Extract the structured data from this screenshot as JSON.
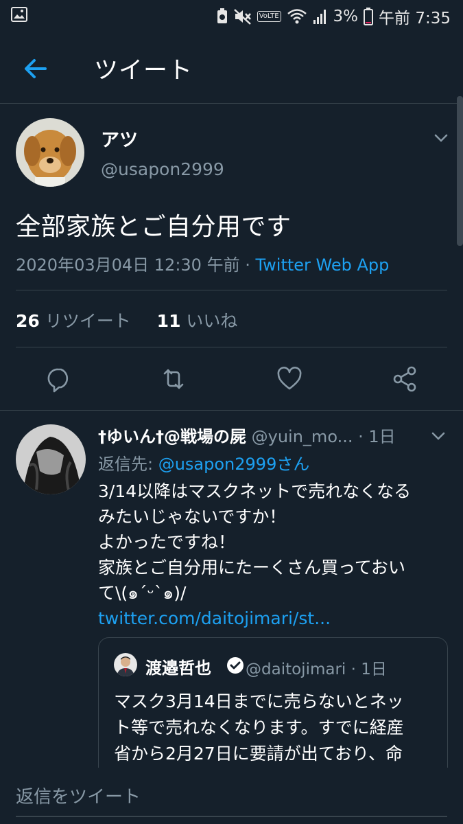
{
  "status_bar": {
    "battery": "3%",
    "time": "午前 7:35",
    "volte": "VoLTE"
  },
  "header": {
    "title": "ツイート"
  },
  "tweet": {
    "display_name": "アツ",
    "handle": "@usapon2999",
    "text": "全部家族とご自分用です",
    "timestamp": "2020年03月04日 12:30 午前",
    "separator": " · ",
    "source": "Twitter Web App",
    "retweet_count": "26",
    "retweet_label": "リツイート",
    "like_count": "11",
    "like_label": "いいね"
  },
  "reply": {
    "display_name": "†ゆいん†@戦場の屍",
    "handle": "@yuin_mo...",
    "time": " · 1日",
    "reply_to_label": "返信先: ",
    "reply_to_mention": "@usapon2999さん",
    "body_lines": [
      "3/14以降はマスクネットで売れなくなる",
      "みたいじゃないですか！",
      "よかったですね！",
      "家族とご自分用にたーくさん買っておい",
      "て\\(๑´ᵕ`๑)/"
    ],
    "link": "twitter.com/daitojimari/st...",
    "quoted": {
      "display_name": "渡邉哲也",
      "handle": "@daitojimari · 1日",
      "text_lines": [
        "マスク3月14日までに売らないとネッ",
        "ト等で売れなくなります。すでに経産",
        "省から2月27日に要請が出ており、命"
      ]
    }
  },
  "reply_bar": {
    "placeholder": "返信をツイート"
  },
  "colors": {
    "background": "#15202b",
    "accent": "#1da1f2",
    "secondary_text": "#8899a6",
    "border": "#38444d"
  },
  "icons": [
    "back-arrow-icon",
    "chevron-down-icon",
    "reply-icon",
    "retweet-icon",
    "like-icon",
    "share-icon",
    "verified-badge-icon"
  ]
}
